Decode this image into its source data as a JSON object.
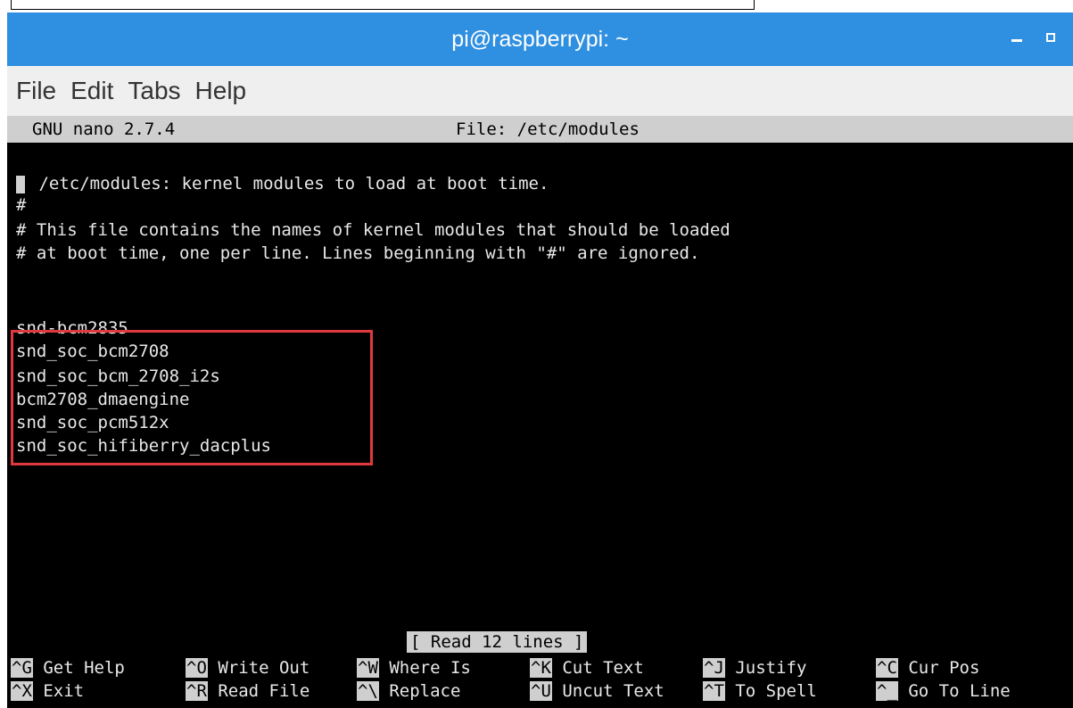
{
  "window": {
    "title": "pi@raspberrypi: ~"
  },
  "menu": [
    "File",
    "Edit",
    "Tabs",
    "Help"
  ],
  "nano": {
    "version": "GNU nano 2.7.4",
    "file": "File: /etc/modules"
  },
  "lines": [
    " /etc/modules: kernel modules to load at boot time.",
    "#",
    "# This file contains the names of kernel modules that should be loaded",
    "# at boot time, one per line. Lines beginning with \"#\" are ignored.",
    "",
    "",
    "snd-bcm2835",
    "snd_soc_bcm2708",
    "snd_soc_bcm_2708_i2s",
    "bcm2708_dmaengine",
    "snd_soc_pcm512x",
    "snd_soc_hifiberry_dacplus"
  ],
  "status": "[ Read 12 lines ]",
  "shortcuts": [
    {
      "key": "^G",
      "label": " Get Help"
    },
    {
      "key": "^O",
      "label": " Write Out"
    },
    {
      "key": "^W",
      "label": " Where Is"
    },
    {
      "key": "^K",
      "label": " Cut Text"
    },
    {
      "key": "^J",
      "label": " Justify"
    },
    {
      "key": "^C",
      "label": " Cur Pos"
    },
    {
      "key": "^X",
      "label": " Exit"
    },
    {
      "key": "^R",
      "label": " Read File"
    },
    {
      "key": "^\\",
      "label": " Replace"
    },
    {
      "key": "^U",
      "label": " Uncut Text"
    },
    {
      "key": "^T",
      "label": " To Spell"
    },
    {
      "key": "^_",
      "label": " Go To Line"
    }
  ],
  "colors": {
    "titlebar": "#2f8fe0",
    "highlight": "#e0393d",
    "terminal_bg": "#000000"
  }
}
